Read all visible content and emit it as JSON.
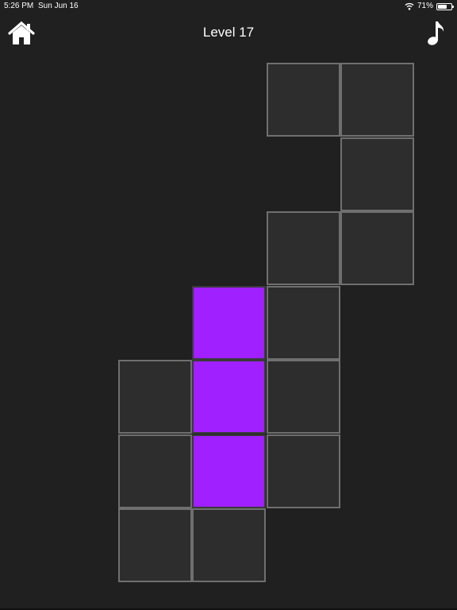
{
  "status_bar": {
    "time": "5:26 PM",
    "date": "Sun Jun 16",
    "battery": "71%",
    "battery_level": 0.71,
    "icons": [
      "wifi-icon",
      "battery-icon"
    ]
  },
  "header": {
    "title": "Level 17",
    "home_icon": "home-icon",
    "music_icon": "music-note-icon"
  },
  "colors": {
    "background": "#202020",
    "tile_empty": "#2d2d2d",
    "tile_border": "#6f6f6f",
    "tile_filled": "#a020ff"
  },
  "board": {
    "rows": 7,
    "cols": 6,
    "tiles": [
      {
        "row": 0,
        "col": 3,
        "state": "empty"
      },
      {
        "row": 0,
        "col": 4,
        "state": "empty"
      },
      {
        "row": 1,
        "col": 4,
        "state": "empty"
      },
      {
        "row": 2,
        "col": 3,
        "state": "empty"
      },
      {
        "row": 2,
        "col": 4,
        "state": "empty"
      },
      {
        "row": 3,
        "col": 2,
        "state": "filled"
      },
      {
        "row": 3,
        "col": 3,
        "state": "empty"
      },
      {
        "row": 4,
        "col": 1,
        "state": "empty"
      },
      {
        "row": 4,
        "col": 2,
        "state": "filled"
      },
      {
        "row": 4,
        "col": 3,
        "state": "empty"
      },
      {
        "row": 5,
        "col": 1,
        "state": "empty"
      },
      {
        "row": 5,
        "col": 2,
        "state": "filled"
      },
      {
        "row": 5,
        "col": 3,
        "state": "empty"
      },
      {
        "row": 6,
        "col": 1,
        "state": "empty"
      },
      {
        "row": 6,
        "col": 2,
        "state": "empty"
      }
    ]
  }
}
